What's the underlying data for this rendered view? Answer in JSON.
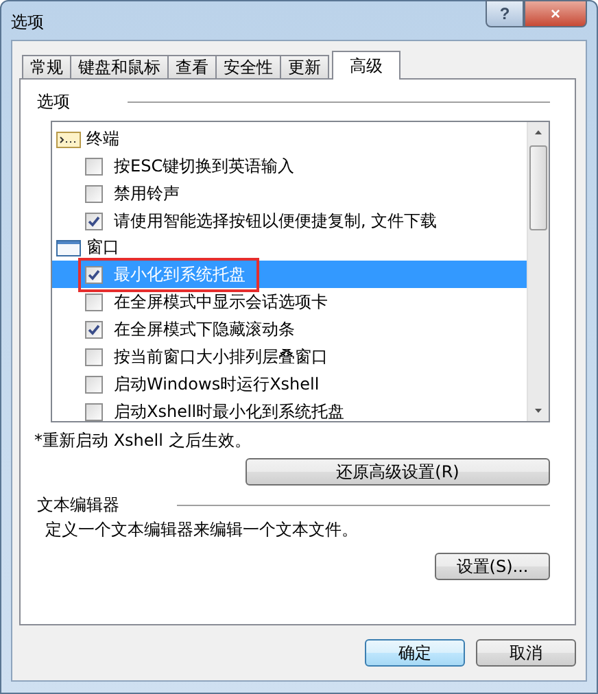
{
  "window": {
    "title": "选项",
    "help_button": "?",
    "close_button": "×"
  },
  "tabs": [
    {
      "label": "常规",
      "selected": false
    },
    {
      "label": "键盘和鼠标",
      "selected": false
    },
    {
      "label": "查看",
      "selected": false
    },
    {
      "label": "安全性",
      "selected": false
    },
    {
      "label": "更新",
      "selected": false
    },
    {
      "label": "高级",
      "selected": true
    }
  ],
  "options": {
    "heading": "选项",
    "tree": [
      {
        "label": "终端",
        "kind": "terminal",
        "children": [
          {
            "label": "按ESC键切换到英语输入",
            "checked": false,
            "selected": false,
            "highlighted": false
          },
          {
            "label": "禁用铃声",
            "checked": false,
            "selected": false,
            "highlighted": false
          },
          {
            "label": "请使用智能选择按钮以便便捷复制, 文件下载",
            "checked": true,
            "selected": false,
            "highlighted": false
          }
        ]
      },
      {
        "label": "窗口",
        "kind": "window",
        "children": [
          {
            "label": "最小化到系统托盘",
            "checked": true,
            "selected": true,
            "highlighted": true
          },
          {
            "label": "在全屏模式中显示会话选项卡",
            "checked": false,
            "selected": false,
            "highlighted": false
          },
          {
            "label": "在全屏模式下隐藏滚动条",
            "checked": true,
            "selected": false,
            "highlighted": false
          },
          {
            "label": "按当前窗口大小排列层叠窗口",
            "checked": false,
            "selected": false,
            "highlighted": false
          },
          {
            "label": "启动Windows时运行Xshell",
            "checked": false,
            "selected": false,
            "highlighted": false
          },
          {
            "label": "启动Xshell时最小化到系统托盘",
            "checked": false,
            "selected": false,
            "highlighted": false
          }
        ]
      }
    ],
    "note": "*重新启动 Xshell 之后生效。",
    "restore_button": "还原高级设置(R)"
  },
  "text_editor": {
    "heading": "文本编辑器",
    "description": "定义一个文本编辑器来编辑一个文本文件。",
    "settings_button": "设置(S)..."
  },
  "buttons": [
    {
      "label": "确定",
      "default": true
    },
    {
      "label": "取消",
      "default": false
    }
  ]
}
